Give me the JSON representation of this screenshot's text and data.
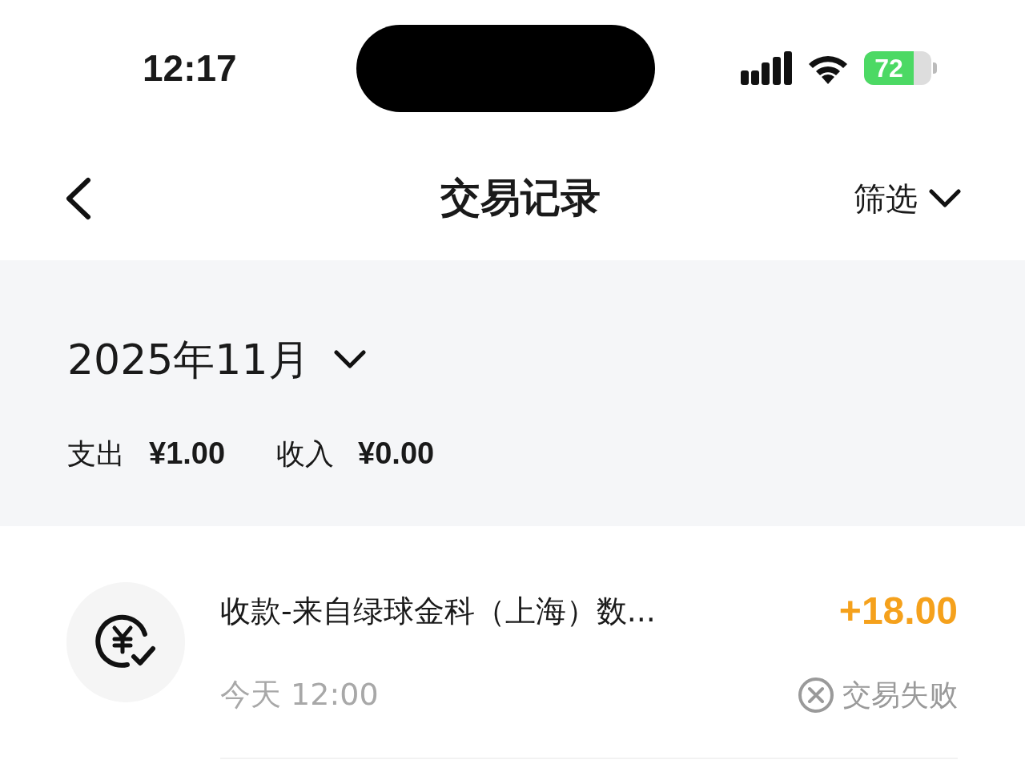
{
  "status_bar": {
    "time": "12:17",
    "battery": "72"
  },
  "header": {
    "title": "交易记录",
    "filter": "筛选"
  },
  "month": {
    "label": "2025年11月"
  },
  "summary": [
    {
      "label": "支出",
      "amount": "¥1.00"
    },
    {
      "label": "收入",
      "amount": "¥0.00"
    }
  ],
  "transactions": [
    {
      "title": "收款-来自绿球金科（上海）数...",
      "amount": "+18.00",
      "time": "今天 12:00",
      "status": "交易失败",
      "failed": true
    }
  ]
}
